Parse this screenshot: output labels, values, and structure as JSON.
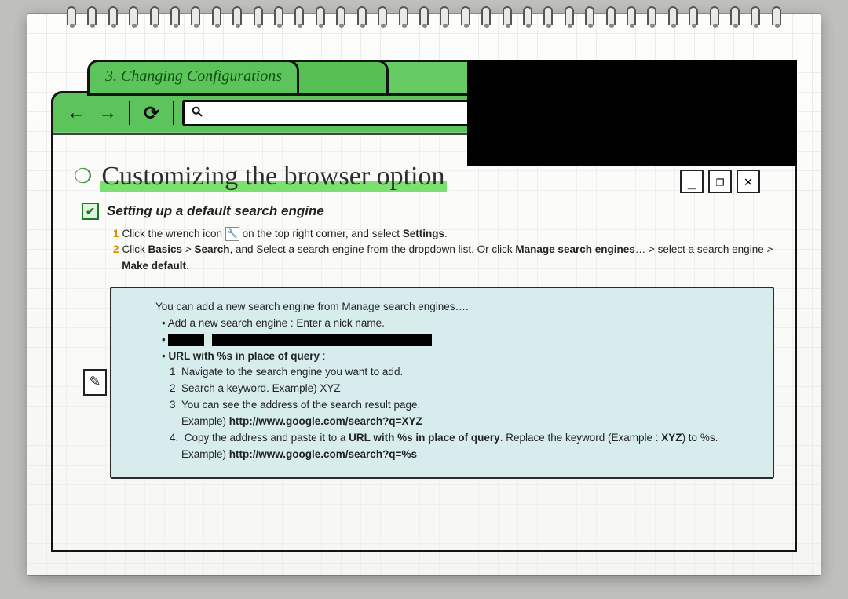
{
  "tab": {
    "label": "3. Changing Configurations"
  },
  "page": {
    "title": "Customizing the browser option",
    "subheading": "Setting up a default search engine"
  },
  "steps": {
    "s1_a": "Click the wrench icon ",
    "s1_b": " on the top right corner, and select ",
    "s1_settings": "Settings",
    "s2_a": "Click ",
    "s2_basics": "Basics",
    "s2_gt1": " > ",
    "s2_search": "Search",
    "s2_b": ", and Select a search engine from the dropdown list.  Or click ",
    "s2_manage": "Manage search engines",
    "s2_c": "… > select a search engine > ",
    "s2_make": "Make default",
    "s2_d": "."
  },
  "info": {
    "intro": "You can add a new search engine from Manage search engines….",
    "bullet1": "Add a new search engine : Enter a nick name.",
    "bullet3_label": "URL with %s in place of query",
    "ol1": "Navigate to the search engine you want to add.",
    "ol2": "Search a keyword.   Example) XYZ",
    "ol3": "You can see the address of the search result page.",
    "ex1_label": "Example)  ",
    "ex1_url": "http://www.google.com/search?q=XYZ",
    "ol4_a": "Copy the address and paste it to a ",
    "ol4_b": "URL with %s in place of query",
    "ol4_c": ". Replace the keyword  (Example : ",
    "ol4_xyz": "XYZ",
    "ol4_d": ") to %s.",
    "ex2_label": "Example) ",
    "ex2_url": "http://www.google.com/search?q=%s"
  },
  "winctrls": {
    "min": "_",
    "max": "❐",
    "close": "✕"
  }
}
